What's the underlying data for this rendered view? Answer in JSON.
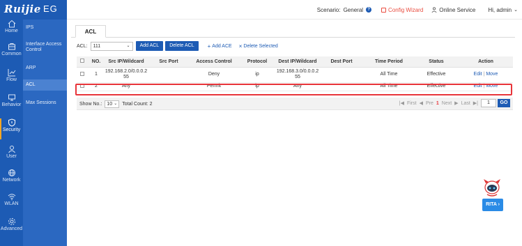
{
  "brand": {
    "logo": "Ruijie",
    "product": "EG"
  },
  "topbar": {
    "scenario_label": "Scenario:",
    "scenario_value": "General",
    "config_wizard": "Config Wizard",
    "online_service": "Online Service",
    "greeting": "Hi, admin"
  },
  "main_nav": [
    {
      "label": "Home",
      "icon": "home-icon"
    },
    {
      "label": "Common",
      "icon": "toolbox-icon"
    },
    {
      "label": "Flow",
      "icon": "flow-chart-icon"
    },
    {
      "label": "Behavior",
      "icon": "behavior-icon"
    },
    {
      "label": "Security",
      "icon": "shield-icon",
      "active": true
    },
    {
      "label": "User",
      "icon": "user-icon"
    },
    {
      "label": "Network",
      "icon": "globe-icon"
    },
    {
      "label": "WLAN",
      "icon": "wifi-icon"
    },
    {
      "label": "Advanced",
      "icon": "gear-icon"
    }
  ],
  "sub_nav": [
    {
      "label": "IPS"
    },
    {
      "label": "Interface Access Control"
    },
    {
      "label": "ARP"
    },
    {
      "label": "ACL",
      "active": true
    },
    {
      "label": "Max Sessions"
    }
  ],
  "tab": {
    "label": "ACL"
  },
  "toolbar": {
    "acl_label": "ACL:",
    "acl_selected": "111",
    "add_acl": "Add ACL",
    "delete_acl": "Delete ACL",
    "add_ace": "Add ACE",
    "delete_selected": "Delete Selected"
  },
  "table": {
    "columns": [
      "",
      "NO.",
      "Src IP/Wildcard",
      "Src Port",
      "Access Control",
      "Protocol",
      "Dest IP/Wildcard",
      "Dest Port",
      "Time Period",
      "Status",
      "Action"
    ],
    "rows": [
      {
        "no": "1",
        "src_ip": "192.168.2.0/0.0.0.255",
        "src_port": "",
        "access": "Deny",
        "protocol": "ip",
        "dest_ip": "192.168.3.0/0.0.0.255",
        "dest_port": "",
        "time": "All Time",
        "status": "Effective",
        "edit": "Edit",
        "sep": "|",
        "move": "Move"
      },
      {
        "no": "2",
        "src_ip": "Any",
        "src_port": "",
        "access": "Permit",
        "protocol": "ip",
        "dest_ip": "Any",
        "dest_port": "",
        "time": "All Time",
        "status": "Effective",
        "edit": "Edit",
        "sep": "|",
        "move": "Move"
      }
    ]
  },
  "footer": {
    "show_no_label": "Show No.:",
    "show_no_value": "10",
    "total_count": "Total Count: 2",
    "first": "First",
    "prev": "Pre",
    "current_page": "1",
    "next": "Next",
    "last": "Last",
    "page_input": "1",
    "go": "GO"
  },
  "assistant": {
    "label": "RITA"
  },
  "colors": {
    "nav_blue": "#1d5bb4",
    "accent_red": "#e94c3f",
    "highlight_red": "#e8343a"
  }
}
